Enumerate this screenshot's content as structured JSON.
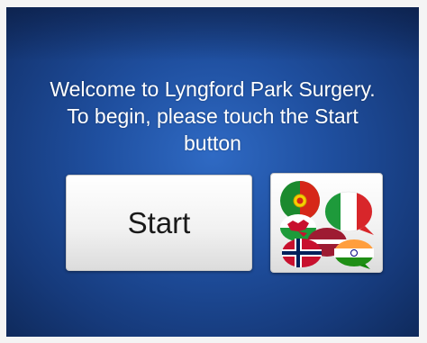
{
  "welcome": {
    "line1": "Welcome to Lyngford Park Surgery.",
    "line2": "To begin, please touch the Start",
    "line3": "button"
  },
  "start_button": {
    "label": "Start"
  },
  "language_button": {
    "icon": "language-flags-icon",
    "flags": [
      "Portugal",
      "Italy",
      "Wales",
      "Latvia",
      "Norway",
      "India"
    ]
  },
  "colors": {
    "background": "#1f4f9f",
    "text": "#ffffff",
    "button_face": "#f2f2f2"
  }
}
